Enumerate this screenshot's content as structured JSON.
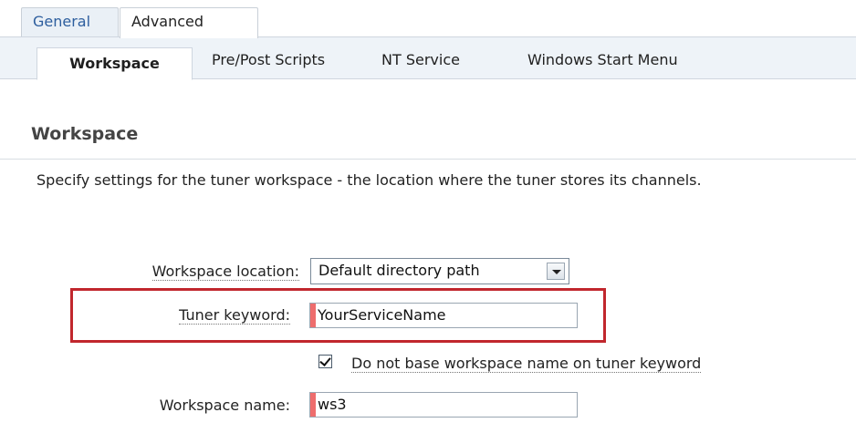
{
  "top_tabs": [
    {
      "label": "General",
      "active": false
    },
    {
      "label": "Advanced",
      "active": true
    }
  ],
  "sub_tabs": [
    {
      "label": "Workspace",
      "active": true
    },
    {
      "label": "Pre/Post Scripts",
      "active": false
    },
    {
      "label": "NT Service",
      "active": false
    },
    {
      "label": "Windows Start Menu",
      "active": false
    }
  ],
  "section": {
    "title": "Workspace",
    "description": "Specify settings for the tuner workspace - the location where the tuner stores its channels."
  },
  "form": {
    "workspace_location": {
      "label": "Workspace location:",
      "value": "Default directory path"
    },
    "tuner_keyword": {
      "label": "Tuner keyword:",
      "value": "YourServiceName"
    },
    "no_base_checkbox": {
      "label": "Do not base workspace name on tuner keyword",
      "checked": true
    },
    "workspace_name": {
      "label": "Workspace name:",
      "value": "ws3"
    }
  },
  "colors": {
    "highlight_border": "#c1272d",
    "required_marker": "#ee6d6d",
    "tab_link": "#2d5e9e"
  }
}
